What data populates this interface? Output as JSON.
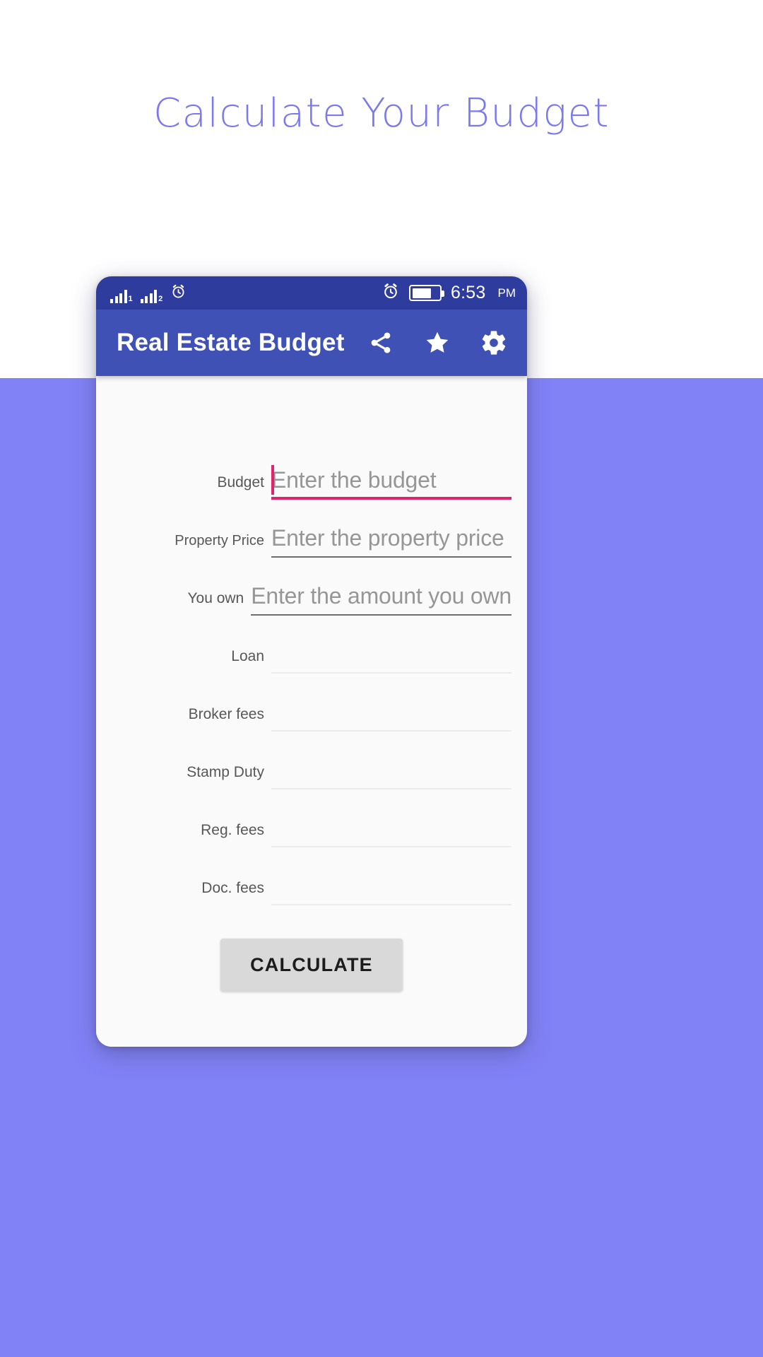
{
  "promo": {
    "title": "Calculate Your Budget",
    "title_color": "#7b79f0",
    "background_color": "#8282f7"
  },
  "status_bar": {
    "time": "6:53",
    "meridiem": "PM",
    "sim1_label": "1",
    "sim2_label": "2",
    "alarm_icon": "alarm-clock-icon",
    "battery_icon": "battery-icon",
    "battery_level_percent": 72,
    "background_color": "#2e3c9d"
  },
  "app_bar": {
    "title": "Real Estate Budget",
    "background_color": "#3f51b5",
    "actions": [
      {
        "name": "share-icon",
        "label": "Share"
      },
      {
        "name": "star-icon",
        "label": "Rate"
      },
      {
        "name": "gear-icon",
        "label": "Settings"
      }
    ]
  },
  "form": {
    "fields": [
      {
        "label": "Budget",
        "placeholder": "Enter the budget",
        "state": "focused",
        "value": ""
      },
      {
        "label": "Property Price",
        "placeholder": "Enter the property price",
        "state": "enabled",
        "value": ""
      },
      {
        "label": "You own",
        "placeholder": "Enter the amount you own",
        "state": "enabled",
        "value": ""
      },
      {
        "label": "Loan",
        "placeholder": "",
        "state": "readonly",
        "value": ""
      },
      {
        "label": "Broker fees",
        "placeholder": "",
        "state": "readonly",
        "value": ""
      },
      {
        "label": "Stamp Duty",
        "placeholder": "",
        "state": "readonly",
        "value": ""
      },
      {
        "label": "Reg. fees",
        "placeholder": "",
        "state": "readonly",
        "value": ""
      },
      {
        "label": "Doc. fees",
        "placeholder": "",
        "state": "readonly",
        "value": ""
      }
    ],
    "focus_accent_color": "#e0246d",
    "submit_label": "CALCULATE"
  }
}
